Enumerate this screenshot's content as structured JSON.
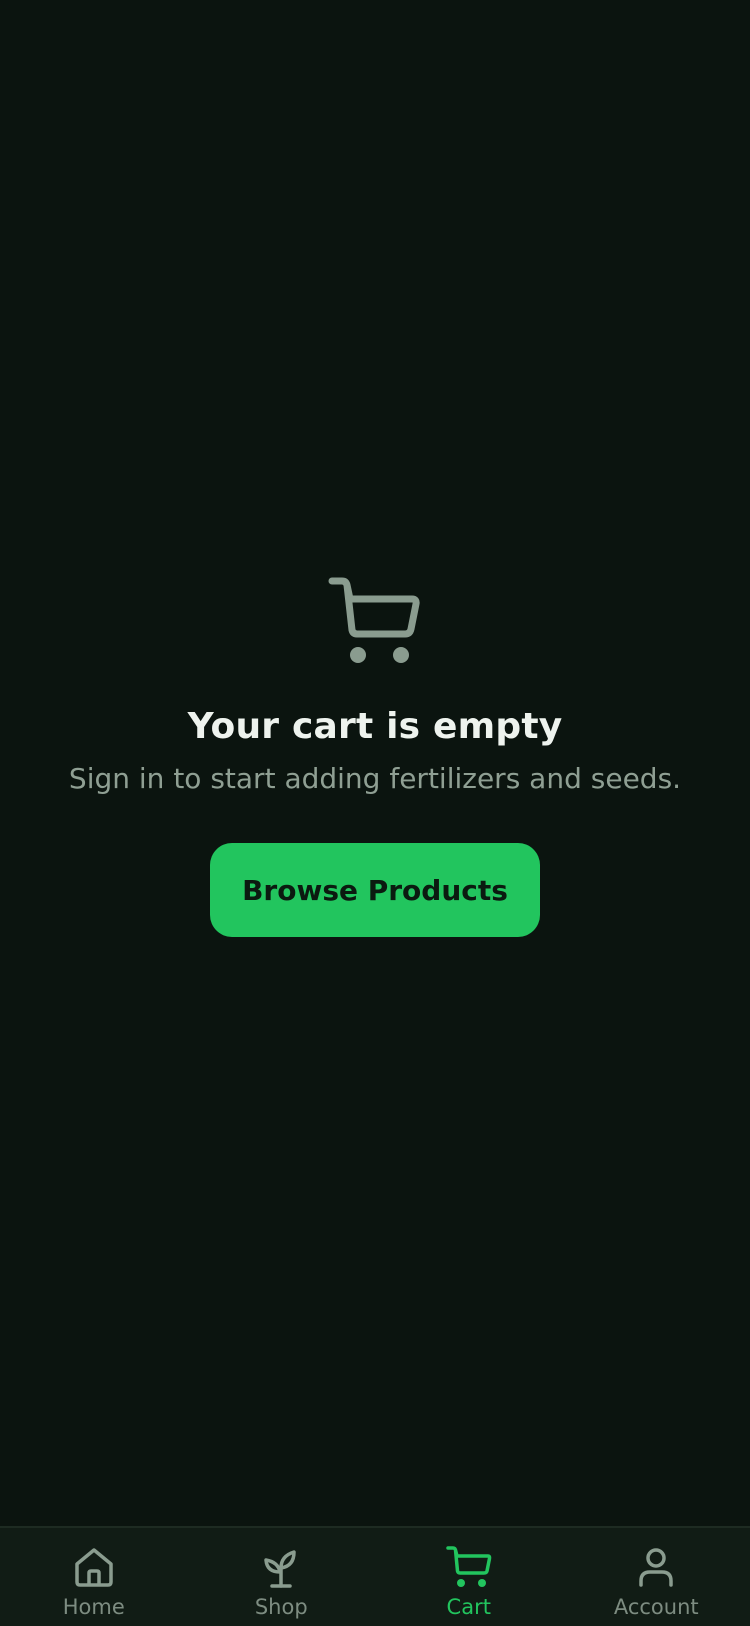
{
  "empty_state": {
    "icon": "shopping-cart-icon",
    "title": "Your cart is empty",
    "subtitle": "Sign in to start adding fertilizers and seeds.",
    "button_label": "Browse Products"
  },
  "tabs": [
    {
      "label": "Home",
      "icon": "home-icon",
      "active": false
    },
    {
      "label": "Shop",
      "icon": "sprout-icon",
      "active": false
    },
    {
      "label": "Cart",
      "icon": "cart-icon",
      "active": true
    },
    {
      "label": "Account",
      "icon": "user-icon",
      "active": false
    }
  ],
  "colors": {
    "background": "#0b140f",
    "accent": "#22c55e",
    "muted_icon": "#8a9c8f",
    "inactive_tab": "#7d8c81",
    "title": "#eef3ee"
  }
}
